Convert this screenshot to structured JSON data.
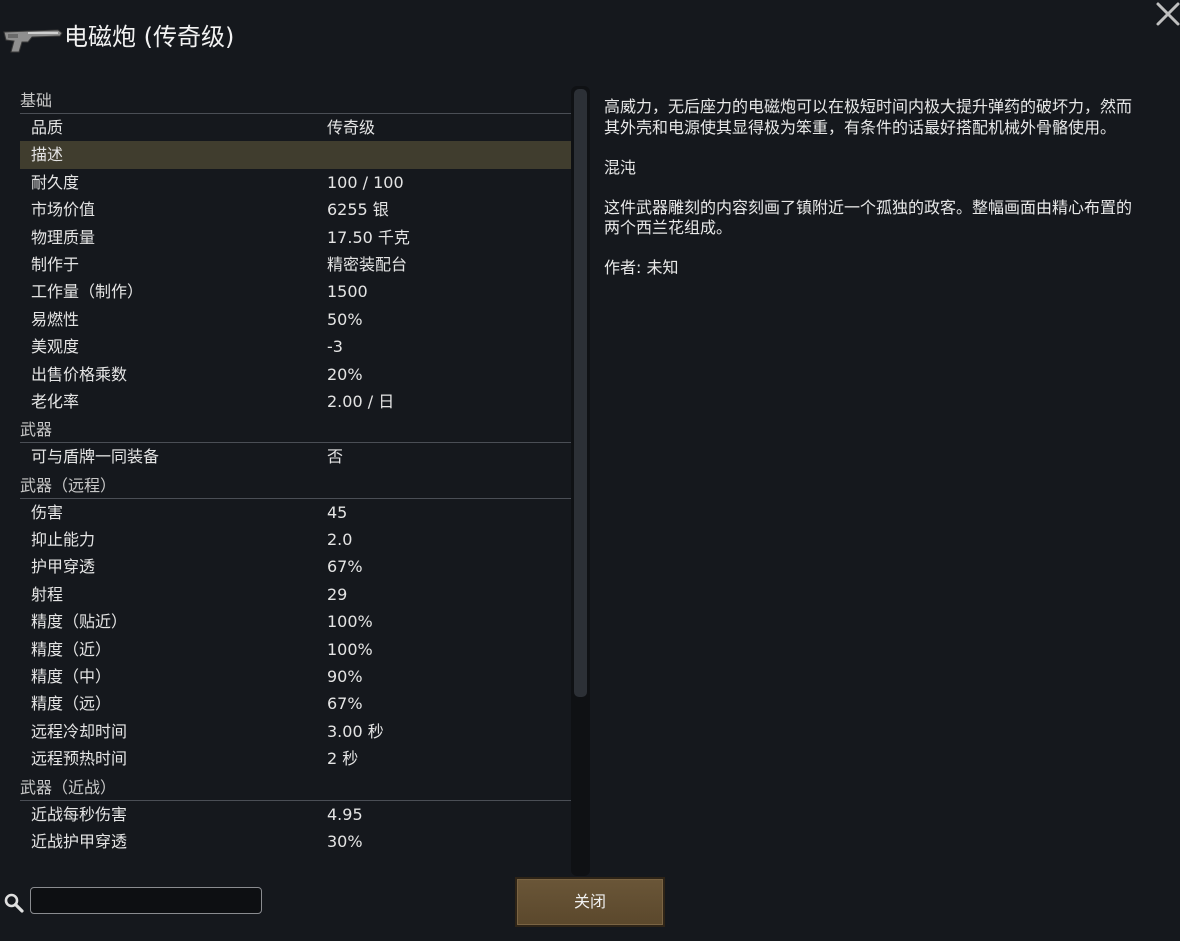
{
  "window": {
    "title": "电磁炮 (传奇级)",
    "close_icon": "close-icon",
    "weapon_icon": "railgun-icon"
  },
  "stats": {
    "sections": [
      {
        "category": "基础",
        "rows": [
          {
            "key": "品质",
            "value": "传奇级"
          },
          {
            "key": "描述",
            "value": "",
            "highlight": true
          },
          {
            "key": "耐久度",
            "value": "100 / 100"
          },
          {
            "key": "市场价值",
            "value": "6255 银"
          },
          {
            "key": "物理质量",
            "value": "17.50 千克"
          },
          {
            "key": "制作于",
            "value": "精密装配台"
          },
          {
            "key": "工作量（制作）",
            "value": "1500"
          },
          {
            "key": "易燃性",
            "value": "50%"
          },
          {
            "key": "美观度",
            "value": "-3"
          },
          {
            "key": "出售价格乘数",
            "value": "20%"
          },
          {
            "key": "老化率",
            "value": "2.00 / 日"
          }
        ]
      },
      {
        "category": "武器",
        "rows": [
          {
            "key": "可与盾牌一同装备",
            "value": "否"
          }
        ]
      },
      {
        "category": "武器（远程）",
        "rows": [
          {
            "key": "伤害",
            "value": "45"
          },
          {
            "key": "抑止能力",
            "value": "2.0"
          },
          {
            "key": "护甲穿透",
            "value": "67%"
          },
          {
            "key": "射程",
            "value": "29"
          },
          {
            "key": "精度（贴近）",
            "value": "100%"
          },
          {
            "key": "精度（近）",
            "value": "100%"
          },
          {
            "key": "精度（中）",
            "value": "90%"
          },
          {
            "key": "精度（远）",
            "value": "67%"
          },
          {
            "key": "远程冷却时间",
            "value": "3.00 秒"
          },
          {
            "key": "远程预热时间",
            "value": "2 秒"
          }
        ]
      },
      {
        "category": "武器（近战）",
        "rows": [
          {
            "key": "近战每秒伤害",
            "value": "4.95"
          },
          {
            "key": "近战护甲穿透",
            "value": "30%"
          }
        ]
      }
    ]
  },
  "description": {
    "paragraphs": [
      "高威力，无后座力的电磁炮可以在极短时间内极大提升弹药的破坏力，然而其外壳和电源使其显得极为笨重，有条件的话最好搭配机械外骨骼使用。",
      "混沌",
      "这件武器雕刻的内容刻画了镇附近一个孤独的政客。整幅画面由精心布置的两个西兰花组成。",
      "作者: 未知"
    ]
  },
  "footer": {
    "search_icon": "search-icon",
    "search_value": "",
    "close_label": "关闭"
  },
  "colors": {
    "background": "#15181d",
    "highlight_row": "#403d2e",
    "button": "#5f4b2e"
  }
}
